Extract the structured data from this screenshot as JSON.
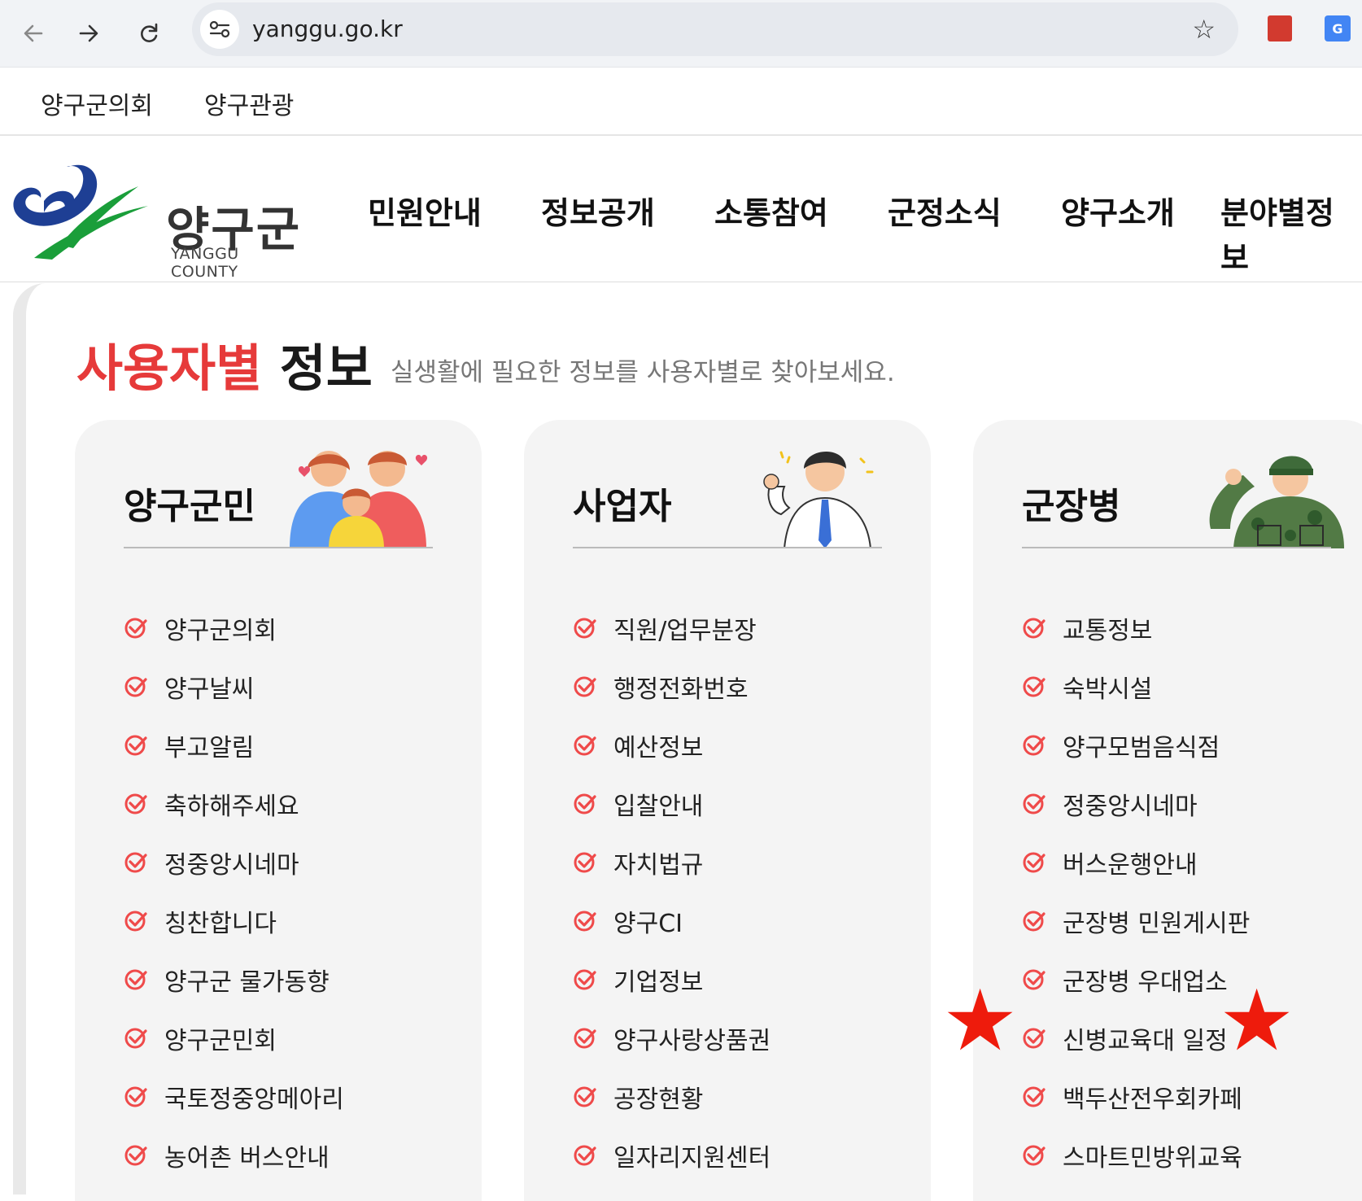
{
  "browser": {
    "url": "yanggu.go.kr",
    "back_icon": "back-arrow-icon",
    "forward_icon": "forward-arrow-icon",
    "reload_icon": "reload-icon"
  },
  "utility_links": [
    "양구군의회",
    "양구관광"
  ],
  "logo": {
    "name_ko": "양구군",
    "name_en": "YANGGU COUNTY"
  },
  "main_nav": [
    "민원안내",
    "정보공개",
    "소통참여",
    "군정소식",
    "양구소개",
    "분야별정보"
  ],
  "section": {
    "title_highlight": "사용자별",
    "title_rest": "정보",
    "subtitle": "실생활에 필요한 정보를 사용자별로 찾아보세요."
  },
  "cards": [
    {
      "title": "양구군민",
      "items": [
        "양구군의회",
        "양구날씨",
        "부고알림",
        "축하해주세요",
        "정중앙시네마",
        "칭찬합니다",
        "양구군 물가동향",
        "양구군민회",
        "국토정중앙메아리",
        "농어촌 버스안내"
      ]
    },
    {
      "title": "사업자",
      "items": [
        "직원/업무분장",
        "행정전화번호",
        "예산정보",
        "입찰안내",
        "자치법규",
        "양구CI",
        "기업정보",
        "양구사랑상품권",
        "공장현황",
        "일자리지원센터"
      ]
    },
    {
      "title": "군장병",
      "items": [
        "교통정보",
        "숙박시설",
        "양구모범음식점",
        "정중앙시네마",
        "버스운행안내",
        "군장병 민원게시판",
        "군장병 우대업소",
        "신병교육대 일정",
        "백두산전우회카페",
        "스마트민방위교육"
      ]
    }
  ],
  "colors": {
    "accent_red": "#e63a3a",
    "star_red": "#ee1b0c",
    "card_bg": "#f4f4f4"
  },
  "annotation": {
    "star_glyph": "★"
  }
}
